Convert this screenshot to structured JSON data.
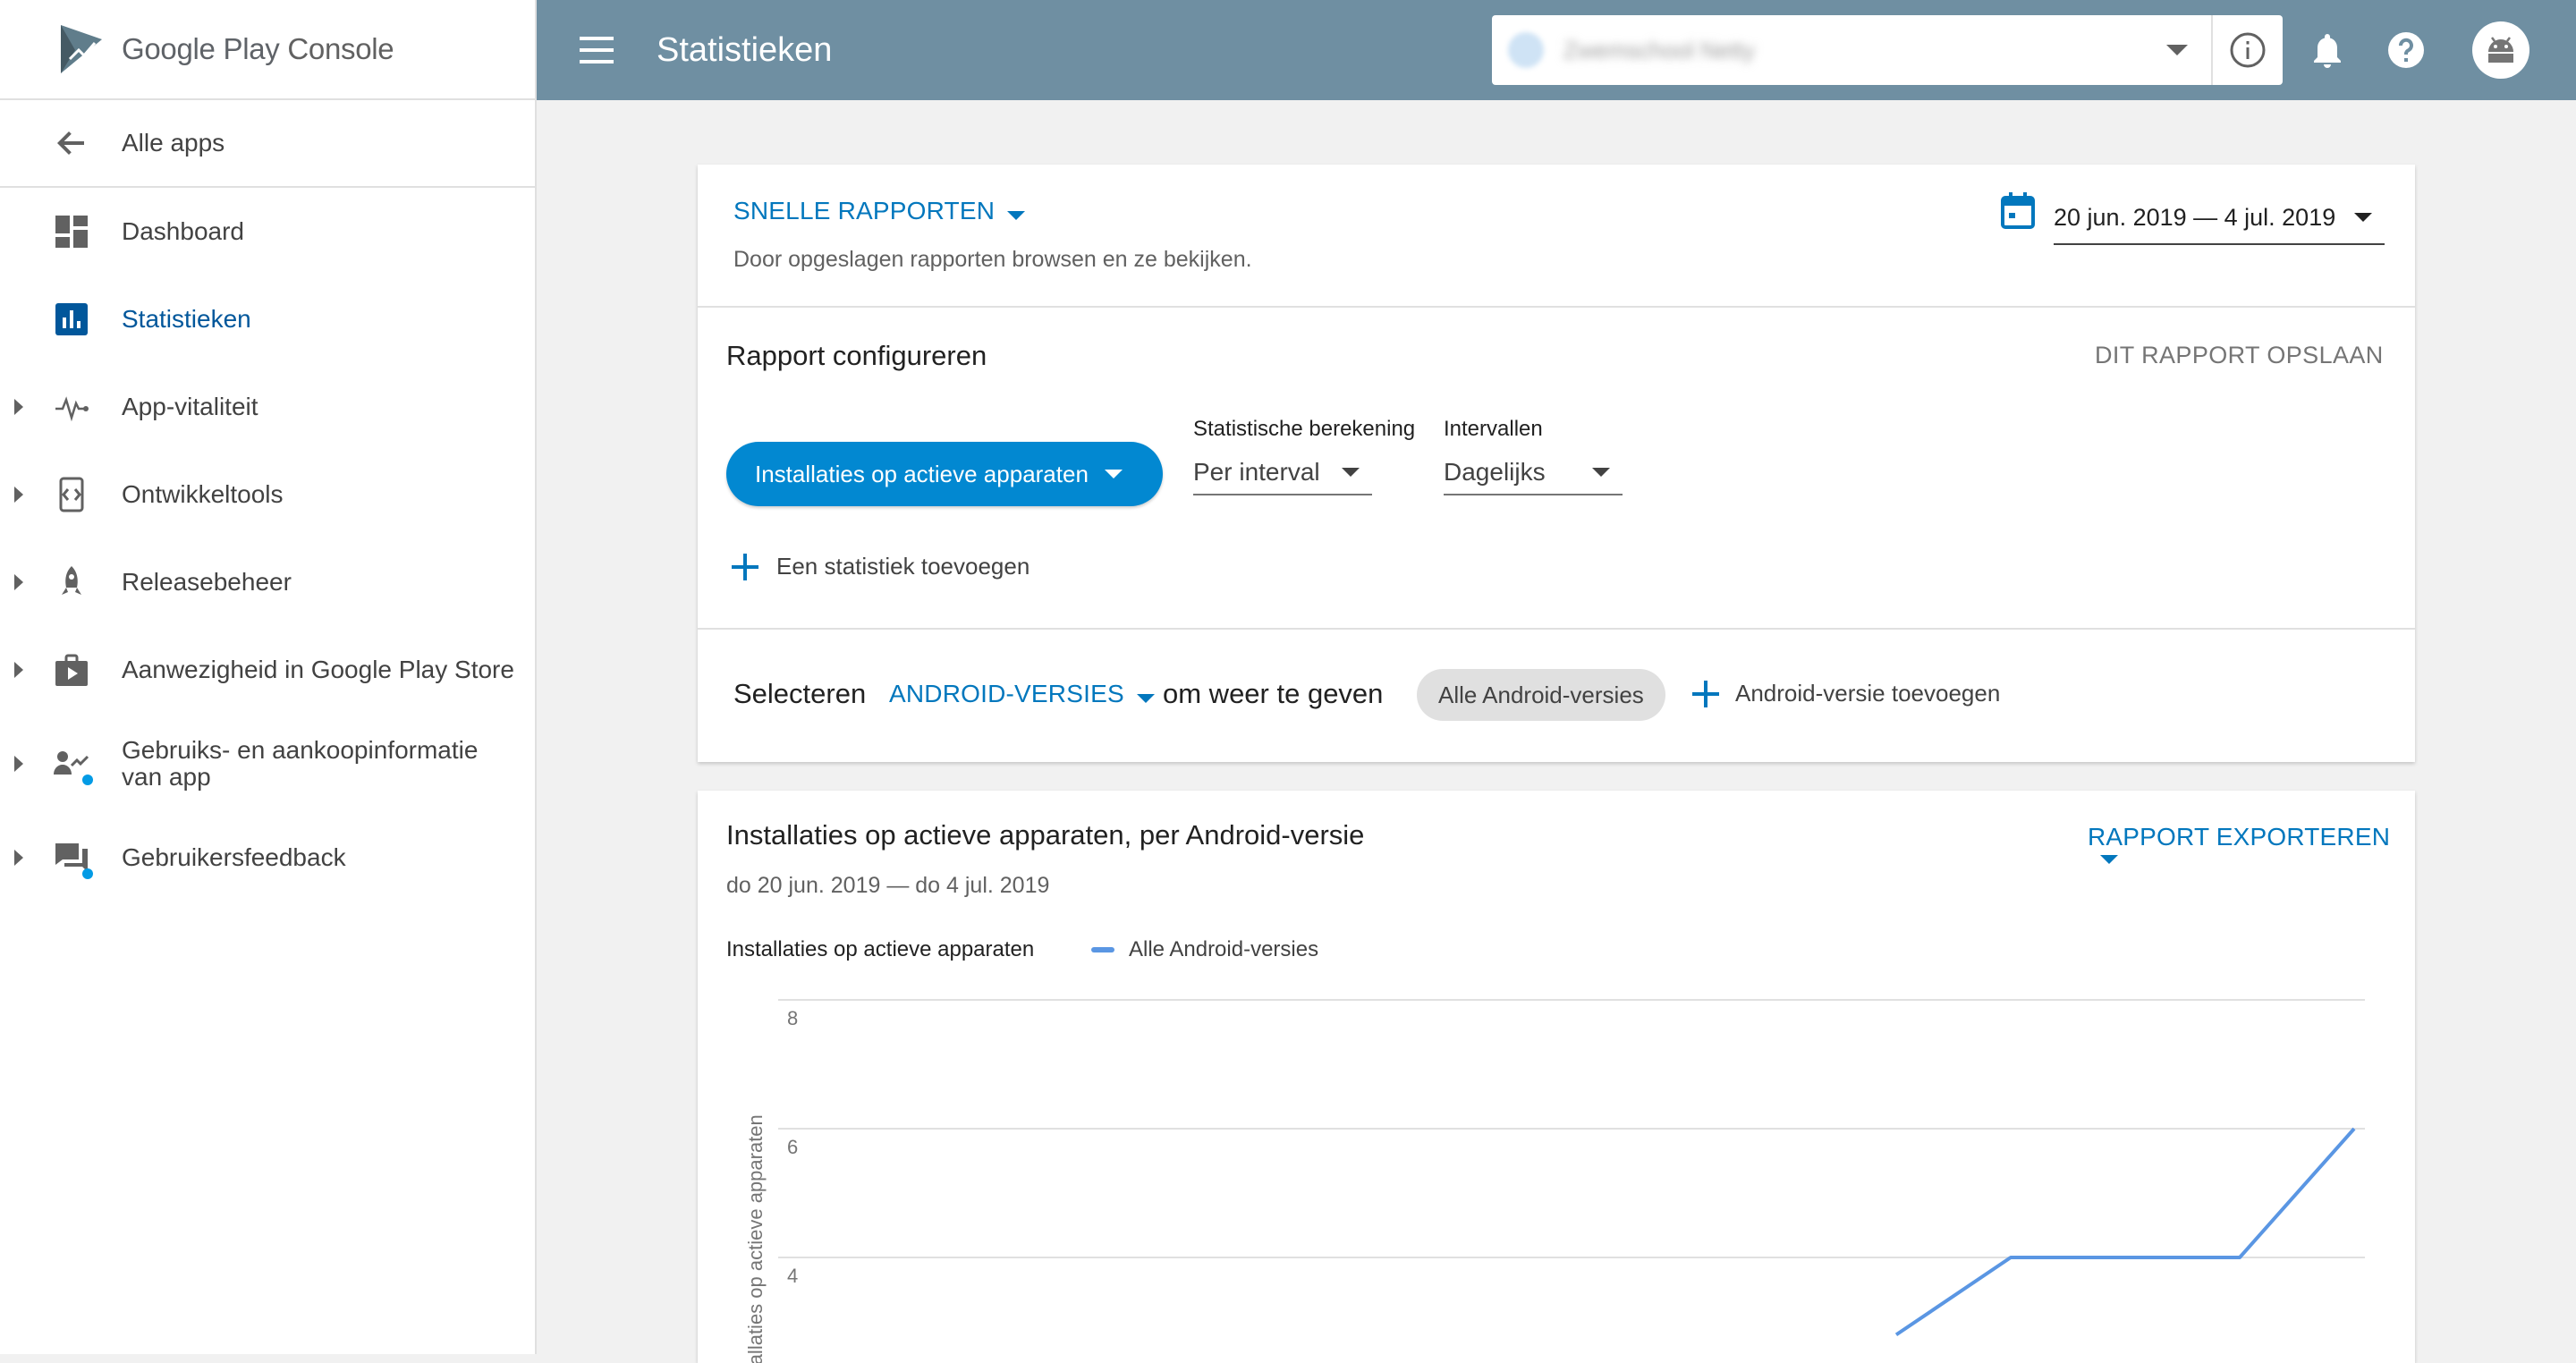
{
  "app": {
    "brand_google": "Google Play",
    "brand_console": "Console"
  },
  "sidebar": {
    "back_label": "Alle apps",
    "items": [
      {
        "label": "Dashboard",
        "icon": "dashboard-icon"
      },
      {
        "label": "Statistieken",
        "icon": "bar-chart-icon",
        "active": true
      },
      {
        "label": "App-vitaliteit",
        "icon": "pulse-icon"
      },
      {
        "label": "Ontwikkeltools",
        "icon": "code-device-icon"
      },
      {
        "label": "Releasebeheer",
        "icon": "rocket-icon"
      },
      {
        "label": "Aanwezigheid in Google Play Store",
        "icon": "play-bag-icon"
      },
      {
        "label_line1": "Gebruiks- en aankoopinformatie",
        "label_line2": "van app",
        "icon": "user-chart-icon"
      },
      {
        "label": "Gebruikersfeedback",
        "icon": "feedback-icon"
      }
    ]
  },
  "header": {
    "title": "Statistieken",
    "app_name": "Zwemschool Netty"
  },
  "quick_reports": {
    "label": "SNELLE RAPPORTEN",
    "description": "Door opgeslagen rapporten browsen en ze bekijken.",
    "date_range": "20 jun. 2019 — 4 jul. 2019"
  },
  "configure": {
    "title": "Rapport configureren",
    "save_label": "DIT RAPPORT OPSLAAN",
    "metric_button": "Installaties op actieve apparaten",
    "calc_label": "Statistische berekening",
    "calc_value": "Per interval",
    "interval_label": "Intervallen",
    "interval_value": "Dagelijks",
    "add_metric": "Een statistiek toevoegen"
  },
  "filter": {
    "select_label": "Selecteren",
    "dimension": "ANDROID-VERSIES",
    "suffix": "om weer te geven",
    "chip": "Alle Android-versies",
    "add_label": "Android-versie toevoegen"
  },
  "report": {
    "title": "Installaties op actieve apparaten, per Android-versie",
    "export_label": "RAPPORT EXPORTEREN",
    "period": "do 20 jun. 2019 — do 4 jul. 2019",
    "metric_label": "Installaties op actieve apparaten"
  },
  "chart_data": {
    "type": "line",
    "ylabel": "Installaties op actieve apparaten",
    "ylim": [
      0,
      8
    ],
    "yticks": [
      "8",
      "6",
      "4"
    ],
    "legend": [
      "Alle Android-versies"
    ],
    "grid": true,
    "series": [
      {
        "name": "Alle Android-versies",
        "color": "#5a96e3",
        "points": [
          {
            "day": 10,
            "value": 2.8
          },
          {
            "day": 11,
            "value": 4
          },
          {
            "day": 12,
            "value": 4
          },
          {
            "day": 13,
            "value": 4
          },
          {
            "day": 14,
            "value": 6
          }
        ]
      }
    ]
  }
}
